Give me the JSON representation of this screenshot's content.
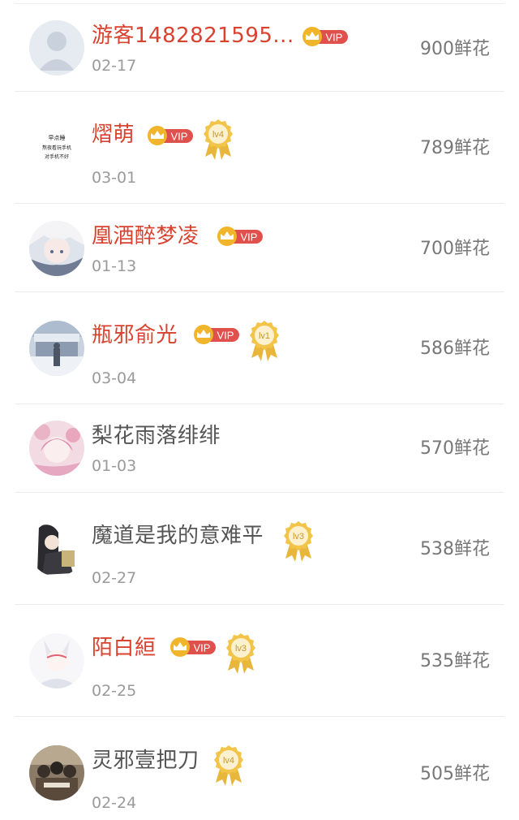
{
  "badge_text": {
    "vip": "VIP"
  },
  "colors": {
    "vip_name": "#d8422f",
    "plain_name": "#555555",
    "date": "#9a9a9a",
    "flowers": "#777777",
    "vip_badge": "#e0504d",
    "crown": "#f1b52c",
    "medal": "#e8b63a"
  },
  "ranking": [
    {
      "name": "游客1482821595...",
      "date": "02-17",
      "flowers": "900鲜花",
      "vip": true,
      "level": "",
      "avatar": "default-avatar"
    },
    {
      "name": "熠萌",
      "date": "03-01",
      "flowers": "789鲜花",
      "vip": true,
      "level": "lv4",
      "avatar": "text-card-avatar"
    },
    {
      "name": "凰酒醉梦凌",
      "date": "01-13",
      "flowers": "700鲜花",
      "vip": true,
      "level": "",
      "avatar": "anime-avatar"
    },
    {
      "name": "瓶邪俞光",
      "date": "03-04",
      "flowers": "586鲜花",
      "vip": true,
      "level": "lv1",
      "avatar": "snow-scene-avatar"
    },
    {
      "name": "梨花雨落绯绯",
      "date": "01-03",
      "flowers": "570鲜花",
      "vip": false,
      "level": "",
      "avatar": "pink-anime-avatar"
    },
    {
      "name": "魔道是我的意难平",
      "date": "02-27",
      "flowers": "538鲜花",
      "vip": false,
      "level": "lv3",
      "avatar": "dark-hair-avatar"
    },
    {
      "name": "陌白絙",
      "date": "02-25",
      "flowers": "535鲜花",
      "vip": true,
      "level": "lv3",
      "avatar": "white-fox-avatar"
    },
    {
      "name": "灵邪壹把刀",
      "date": "02-24",
      "flowers": "505鲜花",
      "vip": false,
      "level": "lv4",
      "avatar": "group-photo-avatar"
    }
  ],
  "avatar_card_text": [
    "早点睡",
    "熬夜看玩手机",
    "对手机不好"
  ]
}
